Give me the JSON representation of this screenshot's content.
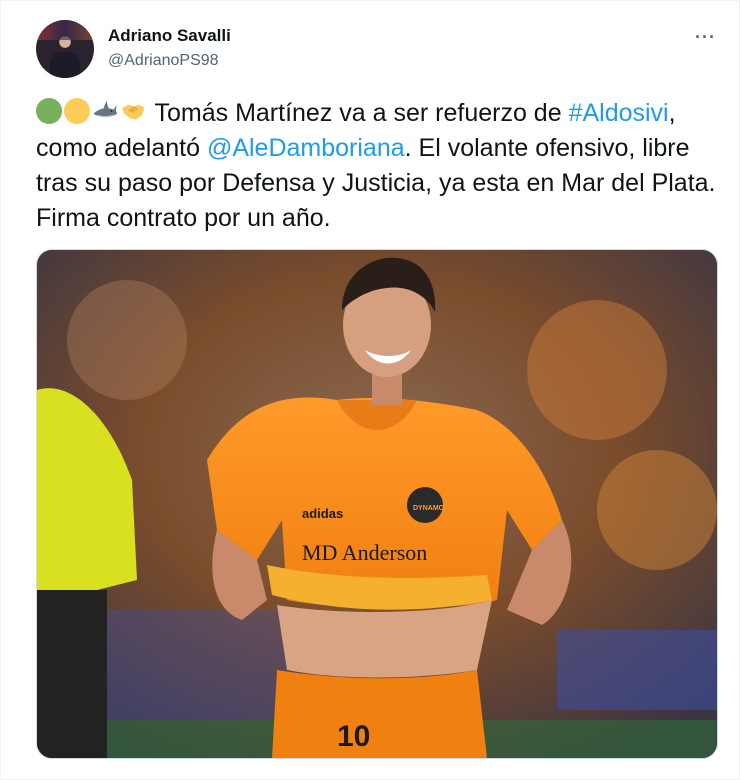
{
  "tweet": {
    "author_name": "Adriano Savalli",
    "author_handle": "@AdrianoPS98",
    "more_label": "···",
    "text_part1": " Tomás Martínez va a ser refuerzo de ",
    "hashtag": "#Aldosivi",
    "text_part2": ", como adelantó ",
    "mention": "@AleDamboriana",
    "text_part3": ". El volante ofensivo, libre tras su paso por Defensa y Justicia, ya esta en Mar del Plata. Firma contrato por un año.",
    "emojis": [
      "green-circle-icon",
      "yellow-circle-icon",
      "shark-icon",
      "handshake-icon"
    ],
    "media": {
      "sponsor_text": "MD Anderson",
      "brand_text": "adidas",
      "crest_text": "DYNAMO",
      "shirt_number": "10"
    }
  }
}
